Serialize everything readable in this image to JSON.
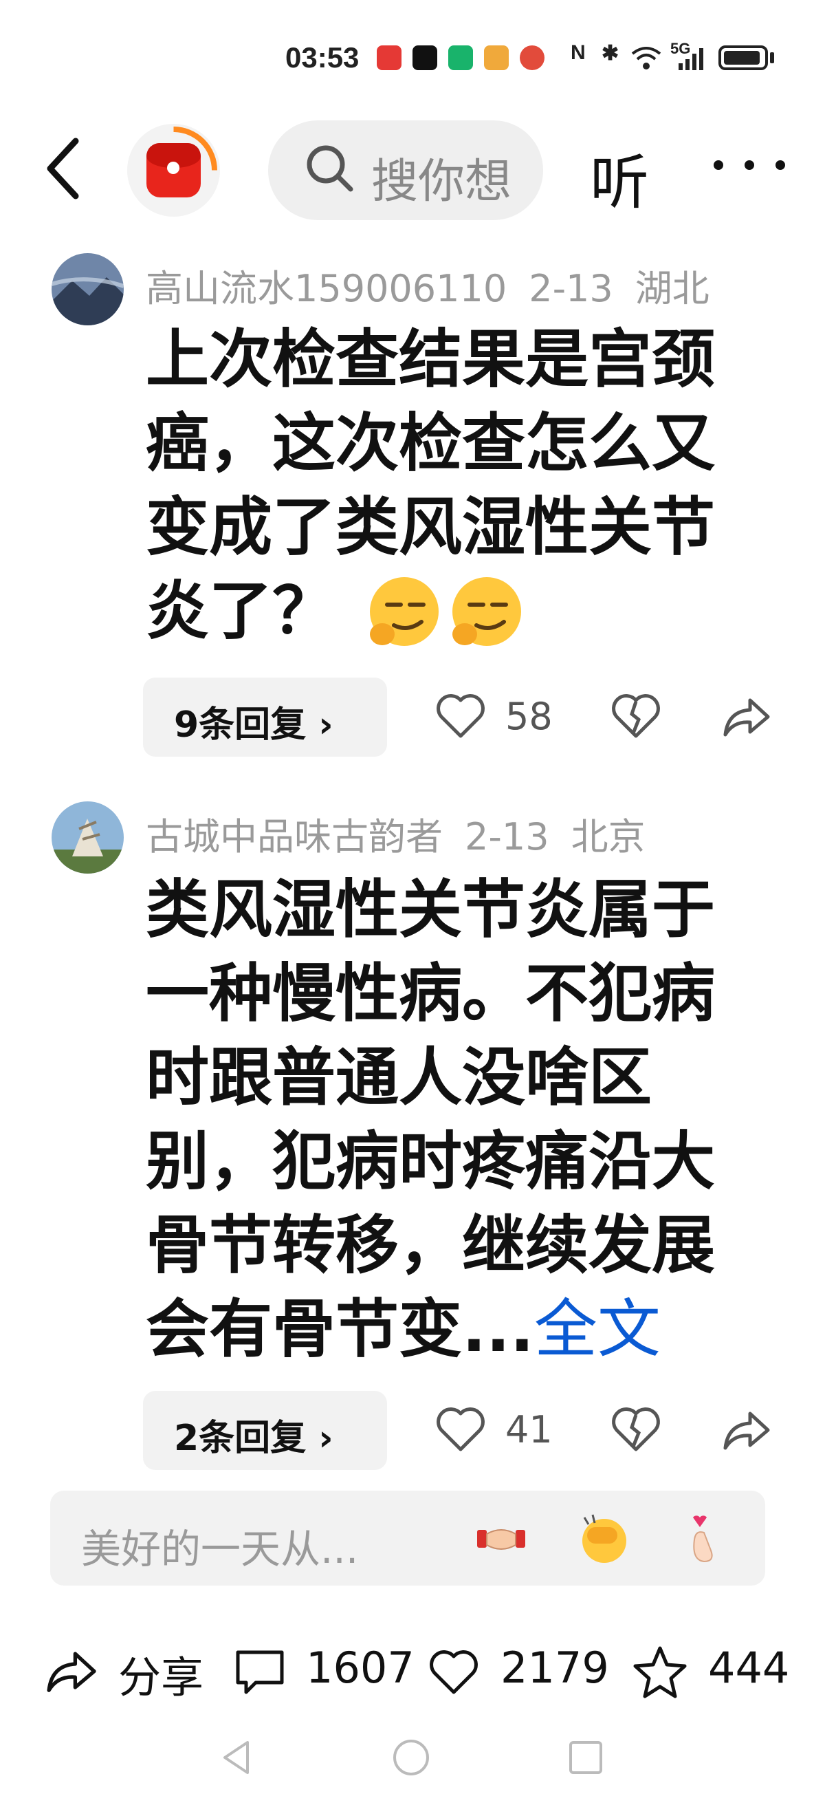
{
  "status_bar": {
    "time": "03:53",
    "network": "5G",
    "colors": {
      "app1": "#e53935",
      "app2": "#111111",
      "app3": "#19b36b",
      "app4": "#f0a93b",
      "app5": "#e24b3b"
    }
  },
  "nav": {
    "search_placeholder": "搜你想",
    "listen_label": "听"
  },
  "comments": [
    {
      "username": "高山流水159006110",
      "date": "2-13",
      "location": "湖北",
      "text_lines": [
        "上次检查结果是宫颈",
        "癌，这次检查怎么又",
        "变成了类风湿性关节",
        "炎了？"
      ],
      "replies_label": "9条回复",
      "likes": "58"
    },
    {
      "username": "古城中品味古韵者",
      "date": "2-13",
      "location": "北京",
      "text_lines": [
        "类风湿性关节炎属于",
        "一种慢性病。不犯病",
        "时跟普通人没啥区",
        "别，犯病时疼痛沿大",
        "骨节转移，继续发展",
        "会有骨节变..."
      ],
      "full_text_label": "全文",
      "replies_label": "2条回复",
      "likes": "41"
    }
  ],
  "input_bar": {
    "placeholder": "美好的一天从..."
  },
  "bottom_bar": {
    "share_label": "分享",
    "comments_count": "1607",
    "likes_count": "2179",
    "favorites_count": "444"
  }
}
